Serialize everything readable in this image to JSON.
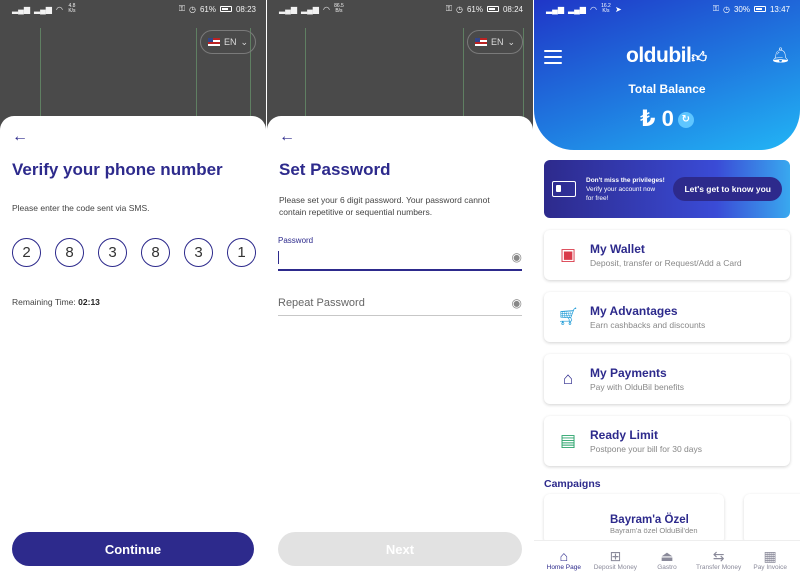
{
  "screen1": {
    "status": {
      "net_speed": "4.8 K/s",
      "battery": "61%",
      "time": "08:23"
    },
    "language": "EN",
    "title": "Verify your phone number",
    "description": "Please enter the code sent via SMS.",
    "otp": [
      "2",
      "8",
      "3",
      "8",
      "3",
      "1"
    ],
    "remaining_label": "Remaining Time:",
    "remaining_value": "02:13",
    "continue_label": "Continue"
  },
  "screen2": {
    "status": {
      "net_speed": "86.5 B/s",
      "battery": "61%",
      "time": "08:24"
    },
    "language": "EN",
    "title": "Set Password",
    "description": "Please set your 6 digit password. Your password cannot contain repetitive or sequential numbers.",
    "password_label": "Password",
    "repeat_placeholder": "Repeat Password",
    "next_label": "Next"
  },
  "screen3": {
    "status": {
      "net_speed": "16.2 K/s",
      "battery": "30%",
      "time": "13:47"
    },
    "logo": "oldubil",
    "total_balance_label": "Total Balance",
    "balance": "₺ 0",
    "promo": {
      "line1": "Don't miss the privileges!",
      "line2": "Verify your account now",
      "line3": "for free!",
      "button": "Let's get to know you"
    },
    "cards": [
      {
        "title": "My Wallet",
        "subtitle": "Deposit, transfer or Request/Add a Card",
        "icon": "wallet-icon",
        "color": "#d93b4a"
      },
      {
        "title": "My Advantages",
        "subtitle": "Earn cashbacks and discounts",
        "icon": "cart-icon",
        "color": "#1e9ad6"
      },
      {
        "title": "My Payments",
        "subtitle": "Pay with OlduBil benefits",
        "icon": "store-icon",
        "color": "#2d2a8c"
      },
      {
        "title": "Ready Limit",
        "subtitle": "Postpone your bill for 30 days",
        "icon": "card-icon",
        "color": "#2aa36b"
      }
    ],
    "campaigns_label": "Campaigns",
    "campaign": {
      "title": "Bayram'a Özel",
      "subtitle": "Bayram'a özel OlduBil'den"
    },
    "nav": [
      {
        "label": "Home Page",
        "icon": "home-icon",
        "active": true
      },
      {
        "label": "Deposit Money",
        "icon": "deposit-icon",
        "active": false
      },
      {
        "label": "Gastro",
        "icon": "gastro-icon",
        "active": false
      },
      {
        "label": "Transfer Money",
        "icon": "transfer-icon",
        "active": false
      },
      {
        "label": "Pay Invoice",
        "icon": "invoice-icon",
        "active": false
      }
    ]
  },
  "colors": {
    "primary": "#2d2a8c",
    "accent": "#1f7ae0",
    "disabled": "#e2e2e2"
  }
}
